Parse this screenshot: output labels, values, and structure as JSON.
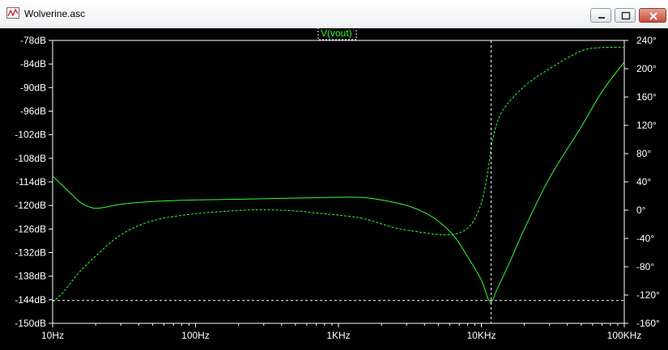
{
  "window": {
    "title": "Wolverine.asc",
    "icon": "waveform-icon",
    "buttons": [
      "minimize-icon",
      "maximize-icon",
      "close-icon"
    ]
  },
  "colors": {
    "background": "#000000",
    "trace": "#33ff33",
    "text": "#ffffff",
    "cursor": "#ffffff"
  },
  "chart_data": {
    "type": "line",
    "trace_name": "V(vout)",
    "x_scale": "log",
    "xlim": [
      10,
      100000
    ],
    "x_ticks": [
      "10Hz",
      "100Hz",
      "1KHz",
      "10KHz",
      "100KHz"
    ],
    "ylim_left": [
      -150,
      -78
    ],
    "y_ticks_left": [
      "-78dB",
      "-84dB",
      "-90dB",
      "-96dB",
      "-102dB",
      "-108dB",
      "-114dB",
      "-120dB",
      "-126dB",
      "-132dB",
      "-138dB",
      "-144dB",
      "-150dB"
    ],
    "ylim_right": [
      -160,
      240
    ],
    "y_ticks_right": [
      "240°",
      "200°",
      "160°",
      "120°",
      "80°",
      "40°",
      "0°",
      "-40°",
      "-80°",
      "-120°",
      "-160°"
    ],
    "series": [
      {
        "style": "solid",
        "axis": "left",
        "points": [
          [
            10,
            -112.5
          ],
          [
            13,
            -116.5
          ],
          [
            16,
            -119.5
          ],
          [
            19,
            -120.6
          ],
          [
            22,
            -120.6
          ],
          [
            30,
            -119.7
          ],
          [
            50,
            -119
          ],
          [
            100,
            -118.6
          ],
          [
            300,
            -118.3
          ],
          [
            1000,
            -117.9
          ],
          [
            1500,
            -118.0
          ],
          [
            2000,
            -118.6
          ],
          [
            3000,
            -120
          ],
          [
            4000,
            -121.8
          ],
          [
            5000,
            -124
          ],
          [
            6500,
            -128
          ],
          [
            8000,
            -133
          ],
          [
            10000,
            -139
          ],
          [
            11500,
            -144.5
          ],
          [
            13000,
            -141
          ],
          [
            16000,
            -134
          ],
          [
            20000,
            -126
          ],
          [
            30000,
            -113
          ],
          [
            50000,
            -100
          ],
          [
            70000,
            -91
          ],
          [
            100000,
            -83.5
          ]
        ]
      },
      {
        "style": "dashed",
        "axis": "right",
        "points": [
          [
            10,
            -130
          ],
          [
            12,
            -115
          ],
          [
            15,
            -90
          ],
          [
            20,
            -65
          ],
          [
            30,
            -35
          ],
          [
            50,
            -15
          ],
          [
            100,
            -5
          ],
          [
            200,
            -0.5
          ],
          [
            300,
            0.5
          ],
          [
            500,
            -1
          ],
          [
            700,
            -4
          ],
          [
            1000,
            -7
          ],
          [
            1500,
            -12
          ],
          [
            2500,
            -25
          ],
          [
            4000,
            -32
          ],
          [
            5500,
            -35
          ],
          [
            7000,
            -32
          ],
          [
            8500,
            -20
          ],
          [
            10000,
            10
          ],
          [
            11000,
            50
          ],
          [
            12000,
            100
          ],
          [
            14000,
            140
          ],
          [
            20000,
            175
          ],
          [
            30000,
            200
          ],
          [
            50000,
            225
          ],
          [
            70000,
            230
          ],
          [
            100000,
            230
          ]
        ]
      }
    ],
    "cursor_x": 11700,
    "cursor_y_db": -144.2
  }
}
